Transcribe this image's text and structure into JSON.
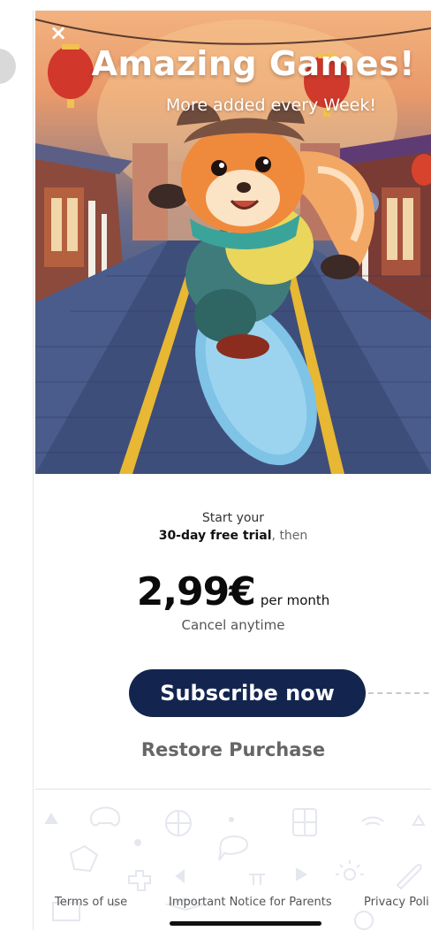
{
  "hero": {
    "title": "Amazing Games!",
    "subtitle": "More added every Week!",
    "close_icon": "×"
  },
  "offer": {
    "trial_line1": "Start your",
    "trial_bold": "30-day free trial",
    "trial_rest": ", then",
    "price": "2,99€",
    "period": "per month",
    "cancel_note": "Cancel anytime"
  },
  "actions": {
    "subscribe_label": "Subscribe now",
    "restore_label": "Restore Purchase"
  },
  "footer": {
    "terms": "Terms of use",
    "parents_notice": "Important Notice for Parents",
    "privacy": "Privacy Poli"
  },
  "colors": {
    "button_bg": "#13254f",
    "button_text": "#ffffff",
    "restore_text": "#666666"
  }
}
